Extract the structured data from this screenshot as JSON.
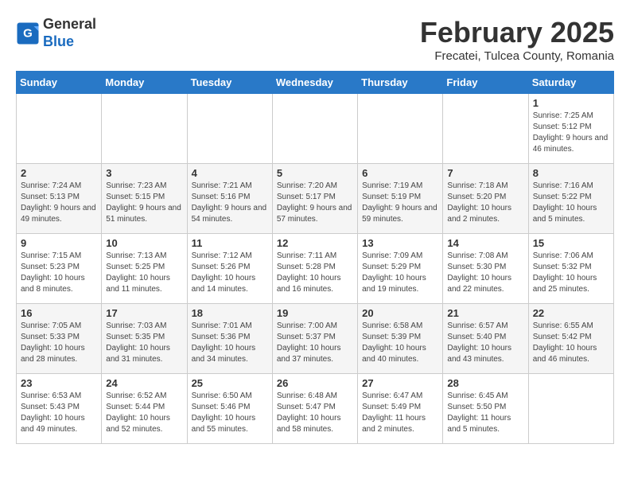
{
  "header": {
    "logo_line1": "General",
    "logo_line2": "Blue",
    "title": "February 2025",
    "subtitle": "Frecatei, Tulcea County, Romania"
  },
  "weekdays": [
    "Sunday",
    "Monday",
    "Tuesday",
    "Wednesday",
    "Thursday",
    "Friday",
    "Saturday"
  ],
  "weeks": [
    [
      {
        "day": "",
        "info": ""
      },
      {
        "day": "",
        "info": ""
      },
      {
        "day": "",
        "info": ""
      },
      {
        "day": "",
        "info": ""
      },
      {
        "day": "",
        "info": ""
      },
      {
        "day": "",
        "info": ""
      },
      {
        "day": "1",
        "info": "Sunrise: 7:25 AM\nSunset: 5:12 PM\nDaylight: 9 hours and 46 minutes."
      }
    ],
    [
      {
        "day": "2",
        "info": "Sunrise: 7:24 AM\nSunset: 5:13 PM\nDaylight: 9 hours and 49 minutes."
      },
      {
        "day": "3",
        "info": "Sunrise: 7:23 AM\nSunset: 5:15 PM\nDaylight: 9 hours and 51 minutes."
      },
      {
        "day": "4",
        "info": "Sunrise: 7:21 AM\nSunset: 5:16 PM\nDaylight: 9 hours and 54 minutes."
      },
      {
        "day": "5",
        "info": "Sunrise: 7:20 AM\nSunset: 5:17 PM\nDaylight: 9 hours and 57 minutes."
      },
      {
        "day": "6",
        "info": "Sunrise: 7:19 AM\nSunset: 5:19 PM\nDaylight: 9 hours and 59 minutes."
      },
      {
        "day": "7",
        "info": "Sunrise: 7:18 AM\nSunset: 5:20 PM\nDaylight: 10 hours and 2 minutes."
      },
      {
        "day": "8",
        "info": "Sunrise: 7:16 AM\nSunset: 5:22 PM\nDaylight: 10 hours and 5 minutes."
      }
    ],
    [
      {
        "day": "9",
        "info": "Sunrise: 7:15 AM\nSunset: 5:23 PM\nDaylight: 10 hours and 8 minutes."
      },
      {
        "day": "10",
        "info": "Sunrise: 7:13 AM\nSunset: 5:25 PM\nDaylight: 10 hours and 11 minutes."
      },
      {
        "day": "11",
        "info": "Sunrise: 7:12 AM\nSunset: 5:26 PM\nDaylight: 10 hours and 14 minutes."
      },
      {
        "day": "12",
        "info": "Sunrise: 7:11 AM\nSunset: 5:28 PM\nDaylight: 10 hours and 16 minutes."
      },
      {
        "day": "13",
        "info": "Sunrise: 7:09 AM\nSunset: 5:29 PM\nDaylight: 10 hours and 19 minutes."
      },
      {
        "day": "14",
        "info": "Sunrise: 7:08 AM\nSunset: 5:30 PM\nDaylight: 10 hours and 22 minutes."
      },
      {
        "day": "15",
        "info": "Sunrise: 7:06 AM\nSunset: 5:32 PM\nDaylight: 10 hours and 25 minutes."
      }
    ],
    [
      {
        "day": "16",
        "info": "Sunrise: 7:05 AM\nSunset: 5:33 PM\nDaylight: 10 hours and 28 minutes."
      },
      {
        "day": "17",
        "info": "Sunrise: 7:03 AM\nSunset: 5:35 PM\nDaylight: 10 hours and 31 minutes."
      },
      {
        "day": "18",
        "info": "Sunrise: 7:01 AM\nSunset: 5:36 PM\nDaylight: 10 hours and 34 minutes."
      },
      {
        "day": "19",
        "info": "Sunrise: 7:00 AM\nSunset: 5:37 PM\nDaylight: 10 hours and 37 minutes."
      },
      {
        "day": "20",
        "info": "Sunrise: 6:58 AM\nSunset: 5:39 PM\nDaylight: 10 hours and 40 minutes."
      },
      {
        "day": "21",
        "info": "Sunrise: 6:57 AM\nSunset: 5:40 PM\nDaylight: 10 hours and 43 minutes."
      },
      {
        "day": "22",
        "info": "Sunrise: 6:55 AM\nSunset: 5:42 PM\nDaylight: 10 hours and 46 minutes."
      }
    ],
    [
      {
        "day": "23",
        "info": "Sunrise: 6:53 AM\nSunset: 5:43 PM\nDaylight: 10 hours and 49 minutes."
      },
      {
        "day": "24",
        "info": "Sunrise: 6:52 AM\nSunset: 5:44 PM\nDaylight: 10 hours and 52 minutes."
      },
      {
        "day": "25",
        "info": "Sunrise: 6:50 AM\nSunset: 5:46 PM\nDaylight: 10 hours and 55 minutes."
      },
      {
        "day": "26",
        "info": "Sunrise: 6:48 AM\nSunset: 5:47 PM\nDaylight: 10 hours and 58 minutes."
      },
      {
        "day": "27",
        "info": "Sunrise: 6:47 AM\nSunset: 5:49 PM\nDaylight: 11 hours and 2 minutes."
      },
      {
        "day": "28",
        "info": "Sunrise: 6:45 AM\nSunset: 5:50 PM\nDaylight: 11 hours and 5 minutes."
      },
      {
        "day": "",
        "info": ""
      }
    ]
  ]
}
